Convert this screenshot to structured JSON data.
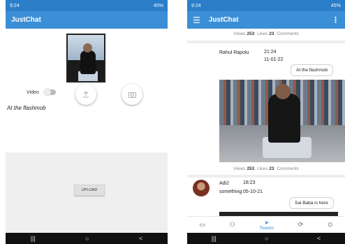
{
  "left": {
    "status": {
      "time": "9:24",
      "right": "45%"
    },
    "app_title": "JustChat",
    "video_label": "Video",
    "caption": "At the flashmob",
    "upload_label": "UPLOAD",
    "nav": {
      "recents": "|||",
      "home": "○",
      "back": "<"
    }
  },
  "right": {
    "status": {
      "time": "9:24",
      "right": "45%"
    },
    "app_title": "JustChat",
    "top_stats": {
      "views_label": "Views",
      "views": "253",
      "likes_label": "Likes",
      "likes": "23",
      "comments_label": "Comments"
    },
    "post1": {
      "author": "Rahul Rapolu",
      "time": "21:24",
      "date": "11-01-22",
      "text": "At the flashmob",
      "stats": {
        "views_label": "Views",
        "views": "253",
        "likes_label": "Likes",
        "likes": "23",
        "comments_label": "Comments"
      }
    },
    "post2": {
      "author": "Adi2",
      "subtitle": "something",
      "time": "18:23",
      "date": "05-10-21",
      "text": "Sai Baba is here"
    },
    "tabs": {
      "active_label": "Tweets"
    },
    "nav": {
      "recents": "|||",
      "home": "○",
      "back": "<"
    }
  },
  "colors": {
    "primary": "#3b8fd6",
    "status": "#2c7ec9"
  }
}
